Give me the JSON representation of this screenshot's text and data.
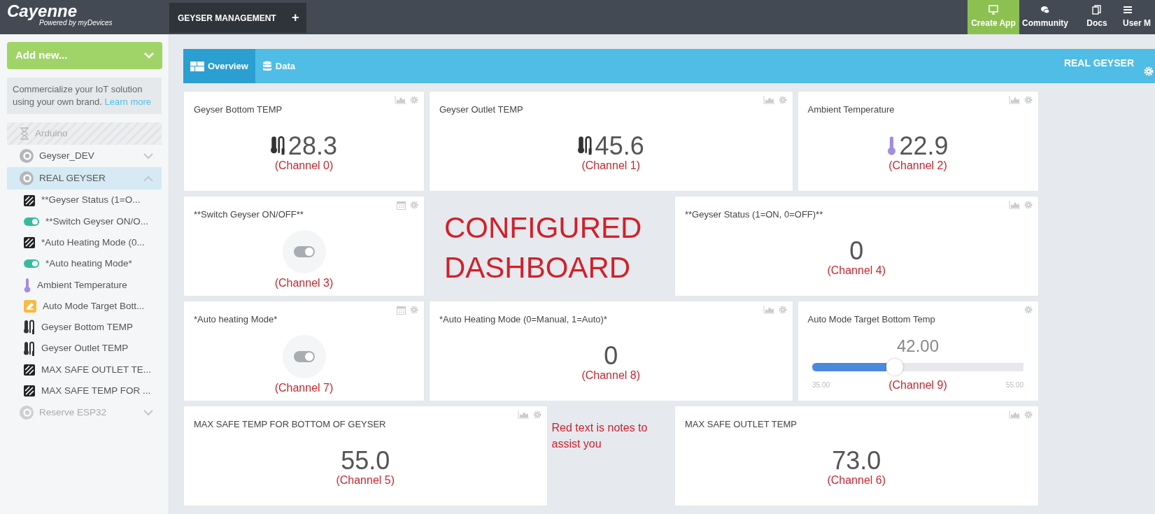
{
  "brand": {
    "name": "Cayenne",
    "tagline": "Powered by myDevices"
  },
  "project_tabs": [
    {
      "label": "GEYSER MANAGEMENT",
      "selected": true
    }
  ],
  "add_tab": "+",
  "top_actions": [
    {
      "label": "Create App",
      "kind": "app"
    },
    {
      "label": "Community",
      "kind": "community"
    },
    {
      "label": "Docs",
      "kind": "docs"
    },
    {
      "label": "User M",
      "kind": "menu"
    }
  ],
  "sidebar": {
    "add_button": "Add new...",
    "promo": {
      "text": "Commercialize your IoT solution using your own brand.",
      "link": "Learn more"
    },
    "devices": [
      {
        "name": "Arduino",
        "kind": "pending",
        "disabled": true,
        "selected": false
      },
      {
        "name": "Geyser_DEV",
        "kind": "device",
        "disabled": false,
        "selected": false,
        "expanded": false
      },
      {
        "name": "REAL GEYSER",
        "kind": "device",
        "disabled": false,
        "selected": true,
        "expanded": true,
        "children": [
          {
            "name": "**Geyser Status (1=O...",
            "kind": "value"
          },
          {
            "name": "**Switch Geyser ON/O...",
            "kind": "switch"
          },
          {
            "name": "*Auto Heating Mode (0...",
            "kind": "value"
          },
          {
            "name": "*Auto heating Mode*",
            "kind": "switch"
          },
          {
            "name": "Ambient Temperature",
            "kind": "thermometer"
          },
          {
            "name": "Auto Mode Target Bott...",
            "kind": "slider"
          },
          {
            "name": "Geyser Bottom TEMP",
            "kind": "probe"
          },
          {
            "name": "Geyser Outlet TEMP",
            "kind": "probe"
          },
          {
            "name": "MAX SAFE OUTLET TE...",
            "kind": "value"
          },
          {
            "name": "MAX SAFE TEMP FOR ...",
            "kind": "value"
          }
        ]
      },
      {
        "name": "Reserve ESP32",
        "kind": "device",
        "disabled": true,
        "selected": false,
        "expanded": false
      }
    ]
  },
  "dashboard": {
    "tabs": [
      {
        "label": "Overview",
        "kind": "overview",
        "selected": true
      },
      {
        "label": "Data",
        "kind": "data",
        "selected": false
      }
    ],
    "device_name": "REAL GEYSER",
    "tiles": [
      {
        "kind": "probe",
        "title": "Geyser Bottom TEMP",
        "value": "28.3",
        "note": "(Channel 0)"
      },
      {
        "kind": "probe",
        "title": "Geyser Outlet TEMP",
        "value": "45.6",
        "note": "(Channel 1)"
      },
      {
        "kind": "thermometer",
        "title": "Ambient Temperature",
        "value": "22.9",
        "note": "(Channel 2)"
      },
      {
        "kind": "toggle",
        "title": "**Switch Geyser ON/OFF**",
        "on": false,
        "note": "(Channel 3)"
      },
      {
        "kind": "annotation",
        "lines": [
          "CONFIGURED",
          "DASHBOARD"
        ]
      },
      {
        "kind": "value",
        "title": "**Geyser Status (1=ON, 0=OFF)**",
        "value": "0",
        "note": "(Channel 4)"
      },
      {
        "kind": "toggle",
        "title": "*Auto heating Mode*",
        "on": false,
        "note": "(Channel 7)"
      },
      {
        "kind": "value",
        "title": "*Auto Heating Mode (0=Manual, 1=Auto)*",
        "value": "0",
        "note": "(Channel 8)"
      },
      {
        "kind": "slider",
        "title": "Auto Mode Target Bottom Temp",
        "value": "42.00",
        "level": 0.35,
        "min": "35.00",
        "max": "55.00",
        "note": "(Channel 9)"
      },
      {
        "kind": "value",
        "title": "MAX SAFE TEMP FOR BOTTOM OF GEYSER",
        "value": "55.0",
        "note": "(Channel 5)"
      },
      {
        "kind": "note",
        "text": "Red text is notes to assist you"
      },
      {
        "kind": "value",
        "title": "MAX SAFE OUTLET TEMP",
        "value": "73.0",
        "note": "(Channel 6)"
      }
    ]
  }
}
